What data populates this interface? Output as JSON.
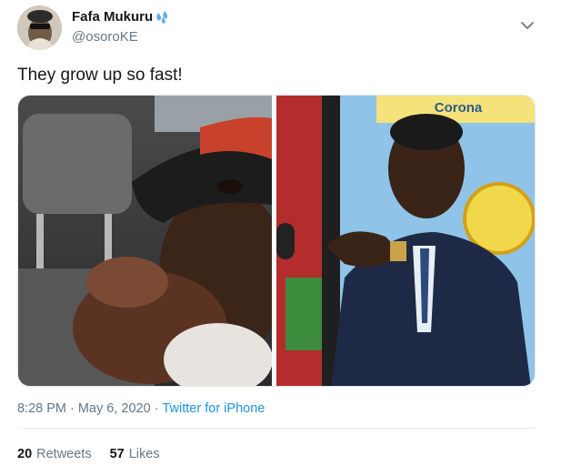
{
  "author": {
    "name": "Fafa Mukuru",
    "name_emoji": "sweat-droplets-icon",
    "handle": "@osoroKE"
  },
  "tweet": {
    "text": "They grow up so fast!"
  },
  "media": {
    "left_image": "child-pointing-in-car-photo",
    "right_image": "man-in-suit-pointing-photo",
    "banner_text": "Corona"
  },
  "meta": {
    "time": "8:28 PM",
    "separator1": "·",
    "date": "May 6, 2020",
    "separator2": "·",
    "source": "Twitter for iPhone"
  },
  "stats": {
    "retweets_count": "20",
    "retweets_label": "Retweets",
    "likes_count": "57",
    "likes_label": "Likes"
  },
  "colors": {
    "text_primary": "#14171a",
    "text_secondary": "#657786",
    "link": "#1b95e0"
  }
}
